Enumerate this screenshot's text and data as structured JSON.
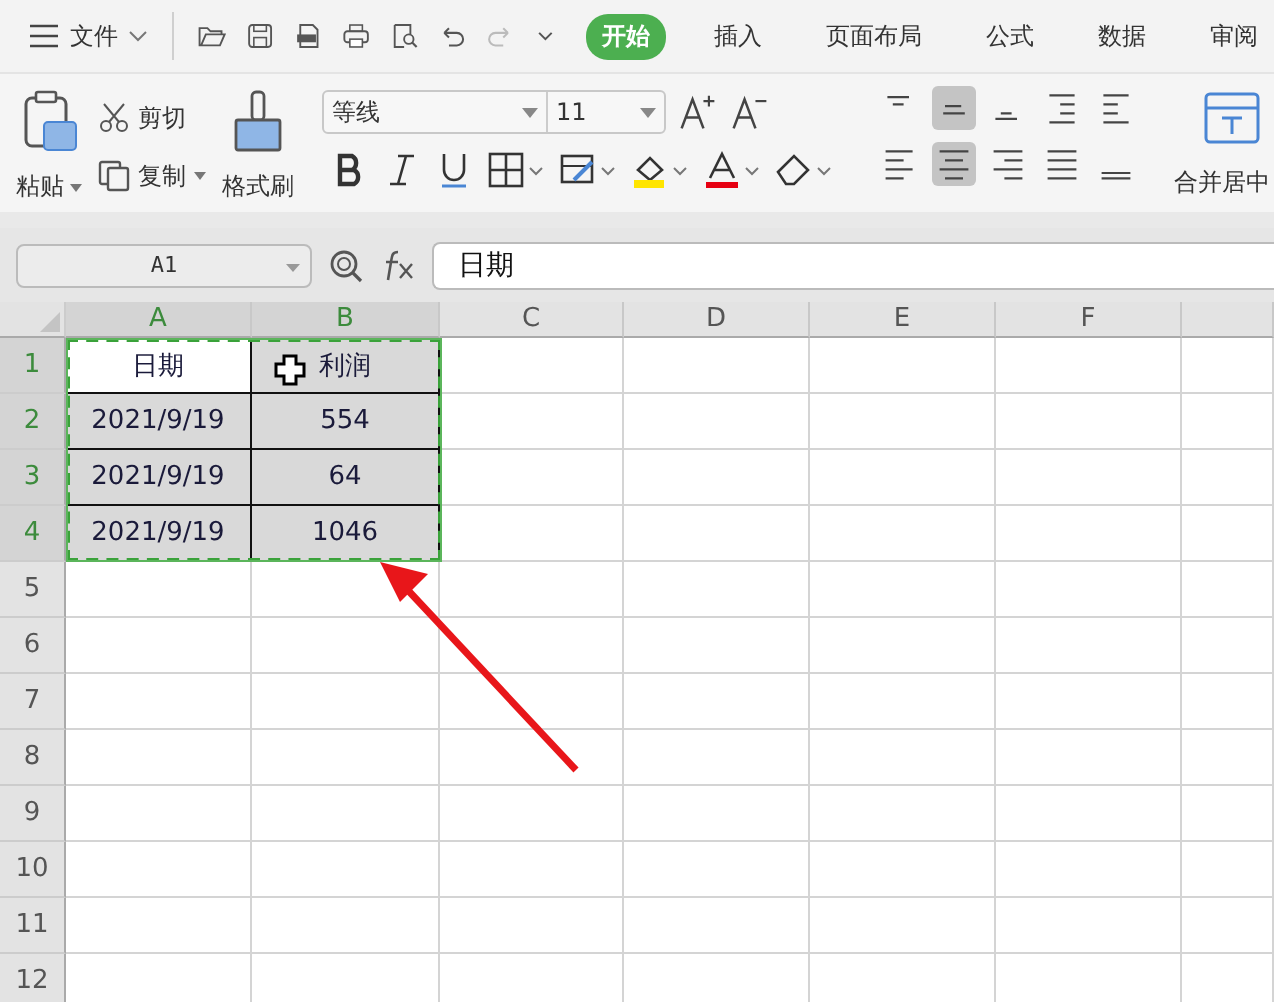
{
  "menu": {
    "label": "文件"
  },
  "tabs": [
    {
      "label": "开始",
      "selected": true
    },
    {
      "label": "插入",
      "selected": false
    },
    {
      "label": "页面布局",
      "selected": false
    },
    {
      "label": "公式",
      "selected": false
    },
    {
      "label": "数据",
      "selected": false
    },
    {
      "label": "审阅",
      "selected": false
    }
  ],
  "clipboard": {
    "paste": "粘贴",
    "cut": "剪切",
    "copy": "复制",
    "format_painter": "格式刷"
  },
  "font": {
    "name": "等线",
    "size": "11"
  },
  "alignment": [
    {
      "kind": "top",
      "selected": false
    },
    {
      "kind": "middle",
      "selected": true
    },
    {
      "kind": "bottom",
      "selected": false
    },
    {
      "kind": "outdent",
      "selected": false
    },
    {
      "kind": "indent",
      "selected": false
    },
    {
      "kind": "left",
      "selected": false
    },
    {
      "kind": "center",
      "selected": true
    },
    {
      "kind": "right",
      "selected": false
    },
    {
      "kind": "justify",
      "selected": false
    },
    {
      "kind": "distribute",
      "selected": false
    }
  ],
  "merge": {
    "label": "合并居中"
  },
  "name_box": "A1",
  "formula": "日期",
  "columns": [
    {
      "label": "A",
      "selected": true
    },
    {
      "label": "B",
      "selected": true
    },
    {
      "label": "C",
      "selected": false
    },
    {
      "label": "D",
      "selected": false
    },
    {
      "label": "E",
      "selected": false
    },
    {
      "label": "F",
      "selected": false
    }
  ],
  "rows": [
    {
      "number": "1",
      "selected": true,
      "cells": [
        "日期",
        "利润"
      ]
    },
    {
      "number": "2",
      "selected": true,
      "cells": [
        "2021/9/19",
        "554"
      ]
    },
    {
      "number": "3",
      "selected": true,
      "cells": [
        "2021/9/19",
        "64"
      ]
    },
    {
      "number": "4",
      "selected": true,
      "cells": [
        "2021/9/19",
        "1046"
      ]
    },
    {
      "number": "5",
      "selected": false
    },
    {
      "number": "6",
      "selected": false
    },
    {
      "number": "7",
      "selected": false
    },
    {
      "number": "8",
      "selected": false
    },
    {
      "number": "9",
      "selected": false
    },
    {
      "number": "10",
      "selected": false
    },
    {
      "number": "11",
      "selected": false
    },
    {
      "number": "12",
      "selected": false
    }
  ]
}
